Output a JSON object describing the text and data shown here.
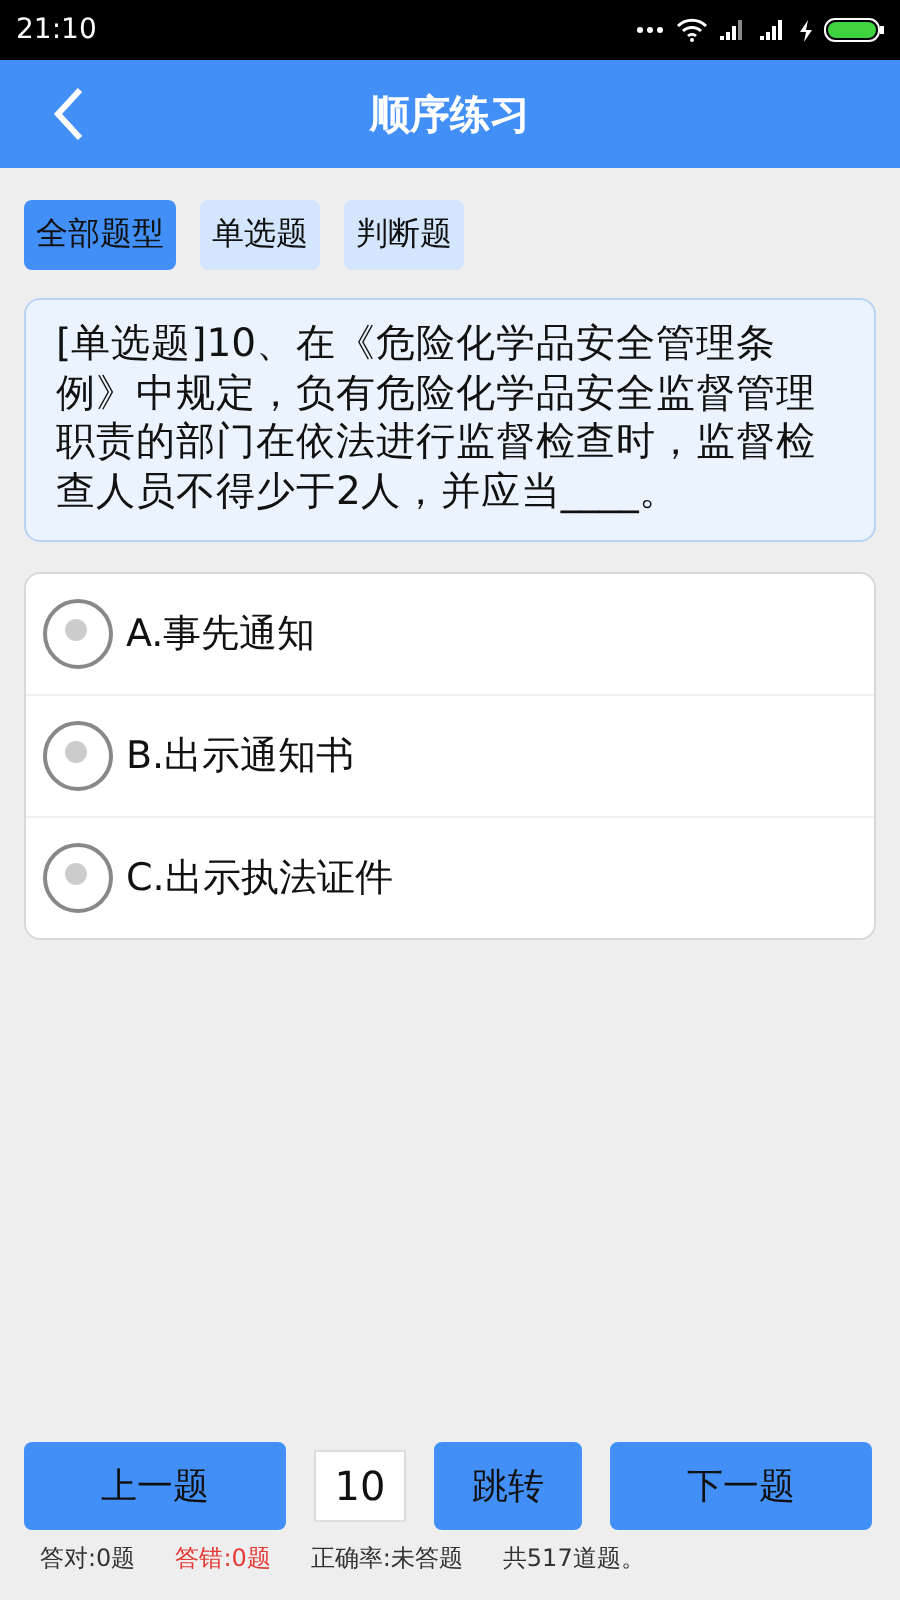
{
  "status_bar": {
    "time": "21:10"
  },
  "header": {
    "title": "顺序练习"
  },
  "tabs": [
    {
      "label": "全部题型",
      "selected": true
    },
    {
      "label": "单选题",
      "selected": false
    },
    {
      "label": "判断题",
      "selected": false
    }
  ],
  "question": {
    "text": "[单选题]10、在《危险化学品安全管理条例》中规定，负有危险化学品安全监督管理职责的部门在依法进行监督检查时，监督检查人员不得少于2人，并应当____。"
  },
  "options": [
    {
      "label": "A.事先通知",
      "selected": false
    },
    {
      "label": "B.出示通知书",
      "selected": false
    },
    {
      "label": "C.出示执法证件",
      "selected": false
    }
  ],
  "nav": {
    "prev": "上一题",
    "jump_value": "10",
    "jump": "跳转",
    "next": "下一题"
  },
  "stats": [
    {
      "text": "答对:0题",
      "color": "#333333"
    },
    {
      "text": "答错:0题",
      "color": "#e53935"
    },
    {
      "text": "正确率:未答题",
      "color": "#333333"
    },
    {
      "text": "共517道题。",
      "color": "#333333"
    }
  ]
}
